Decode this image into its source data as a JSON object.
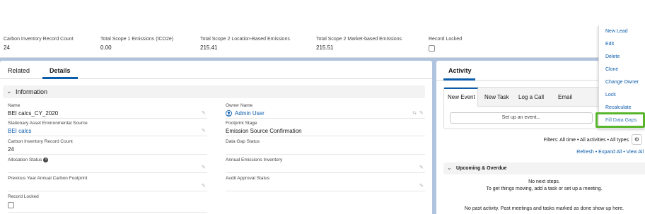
{
  "highlights": {
    "fields": [
      {
        "label": "Carbon Inventory Record Count",
        "value": "24"
      },
      {
        "label": "Total Scope 1 Emissions (tCO2e)",
        "value": "0.00"
      },
      {
        "label": "Total Scope 2 Location-Based Emissions",
        "value": "215.41"
      },
      {
        "label": "Total Scope 2 Market-based Emissions",
        "value": "215.51"
      },
      {
        "label": "Record Locked",
        "value": ""
      }
    ]
  },
  "menu": {
    "items": [
      "New Lead",
      "Edit",
      "Delete",
      "Clone",
      "Change Owner",
      "Lock",
      "Recalculate",
      "Fill Data Gaps"
    ],
    "highlighted_item": "Fill Data Gaps",
    "highlight_color": "#58b52c"
  },
  "tabs": {
    "related": "Related",
    "details": "Details",
    "active": "Details"
  },
  "section": {
    "title": "Information"
  },
  "details": {
    "left": [
      {
        "label": "Name",
        "value": "BEI calcs_CY_2020"
      },
      {
        "label": "Stationary Asset Environmental Source",
        "value": "BEI calcs"
      },
      {
        "label": "Carbon Inventory Record Count",
        "value": "24"
      },
      {
        "label": "Allocation Status",
        "value": ""
      },
      {
        "label": "Previous Year Annual Carbon Footprint",
        "value": ""
      },
      {
        "label": "Record Locked",
        "value": ""
      }
    ],
    "right": [
      {
        "label": "Owner Name",
        "value": "Admin User"
      },
      {
        "label": "Footprint Stage",
        "value": "Emission Source Confirmation"
      },
      {
        "label": "Data Gap Status",
        "value": ""
      },
      {
        "label": "Annual Emissions Inventory",
        "value": ""
      },
      {
        "label": "Audit Approval Status",
        "value": ""
      }
    ]
  },
  "activity": {
    "title": "Activity",
    "composer_tabs": [
      "New Event",
      "New Task",
      "Log a Call",
      "Email"
    ],
    "active_composer_tab": "New Event",
    "input_placeholder": "Set up an event...",
    "filters": "Filters: All time • All activities • All types",
    "links": [
      "Refresh",
      "Expand All",
      "View All"
    ],
    "link_separator": "•",
    "upcoming_title": "Upcoming & Overdue",
    "no_steps_line1": "No next steps.",
    "no_steps_line2": "To get things moving, add a task or set up a meeting.",
    "past_activity": "No past activity. Past meetings and tasks marked as done show up here."
  },
  "colors": {
    "brand_blue": "#0b5cab",
    "page_background": "#b0c4df"
  }
}
